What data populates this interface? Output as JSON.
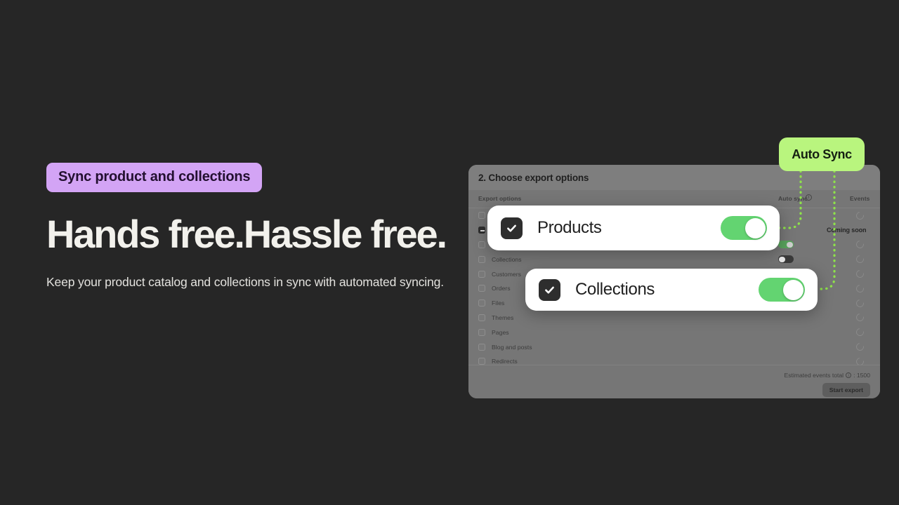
{
  "hero": {
    "eyebrow": "Sync product and collections",
    "headline": "Hands free.Hassle free.",
    "subhead": "Keep your product catalog and collections in sync with automated syncing.",
    "eyebrow_color": "#d3a4f5",
    "background_color": "#262626"
  },
  "badge": {
    "label": "Auto Sync",
    "color": "#b9f57e"
  },
  "panel": {
    "title": "2. Choose export options",
    "columns": {
      "export_options": "Export options",
      "auto_sync": "Auto sync",
      "events": "Events",
      "info_icon": "info-icon"
    },
    "options": [
      {
        "label": "",
        "checkbox": "unchecked",
        "auto_sync": "none",
        "events": "spinner"
      },
      {
        "label": "",
        "checkbox": "indeterminate",
        "auto_sync": "none",
        "events": "coming-soon",
        "events_text": "Coming soon"
      },
      {
        "label": "",
        "checkbox": "unchecked",
        "auto_sync": "on",
        "events": "spinner"
      },
      {
        "label": "Collections",
        "checkbox": "unchecked",
        "auto_sync": "off",
        "events": "spinner"
      },
      {
        "label": "Customers",
        "checkbox": "unchecked",
        "auto_sync": "none",
        "events": "spinner"
      },
      {
        "label": "Orders",
        "checkbox": "unchecked",
        "auto_sync": "none",
        "events": "spinner"
      },
      {
        "label": "Files",
        "checkbox": "unchecked",
        "auto_sync": "none",
        "events": "spinner"
      },
      {
        "label": "Themes",
        "checkbox": "unchecked",
        "auto_sync": "none",
        "events": "spinner"
      },
      {
        "label": "Pages",
        "checkbox": "unchecked",
        "auto_sync": "none",
        "events": "spinner"
      },
      {
        "label": "Blog and posts",
        "checkbox": "unchecked",
        "auto_sync": "none",
        "events": "spinner"
      },
      {
        "label": "Redirects",
        "checkbox": "unchecked",
        "auto_sync": "none",
        "events": "spinner"
      }
    ],
    "footer": {
      "estimated_label": "Estimated events total",
      "estimated_separator": ": ",
      "estimated_value": "1500",
      "start_export": "Start export"
    }
  },
  "cards": [
    {
      "label": "Products",
      "checked": true,
      "toggle": "on",
      "toggle_color": "#63d471"
    },
    {
      "label": "Collections",
      "checked": true,
      "toggle": "on",
      "toggle_color": "#63d471"
    }
  ]
}
